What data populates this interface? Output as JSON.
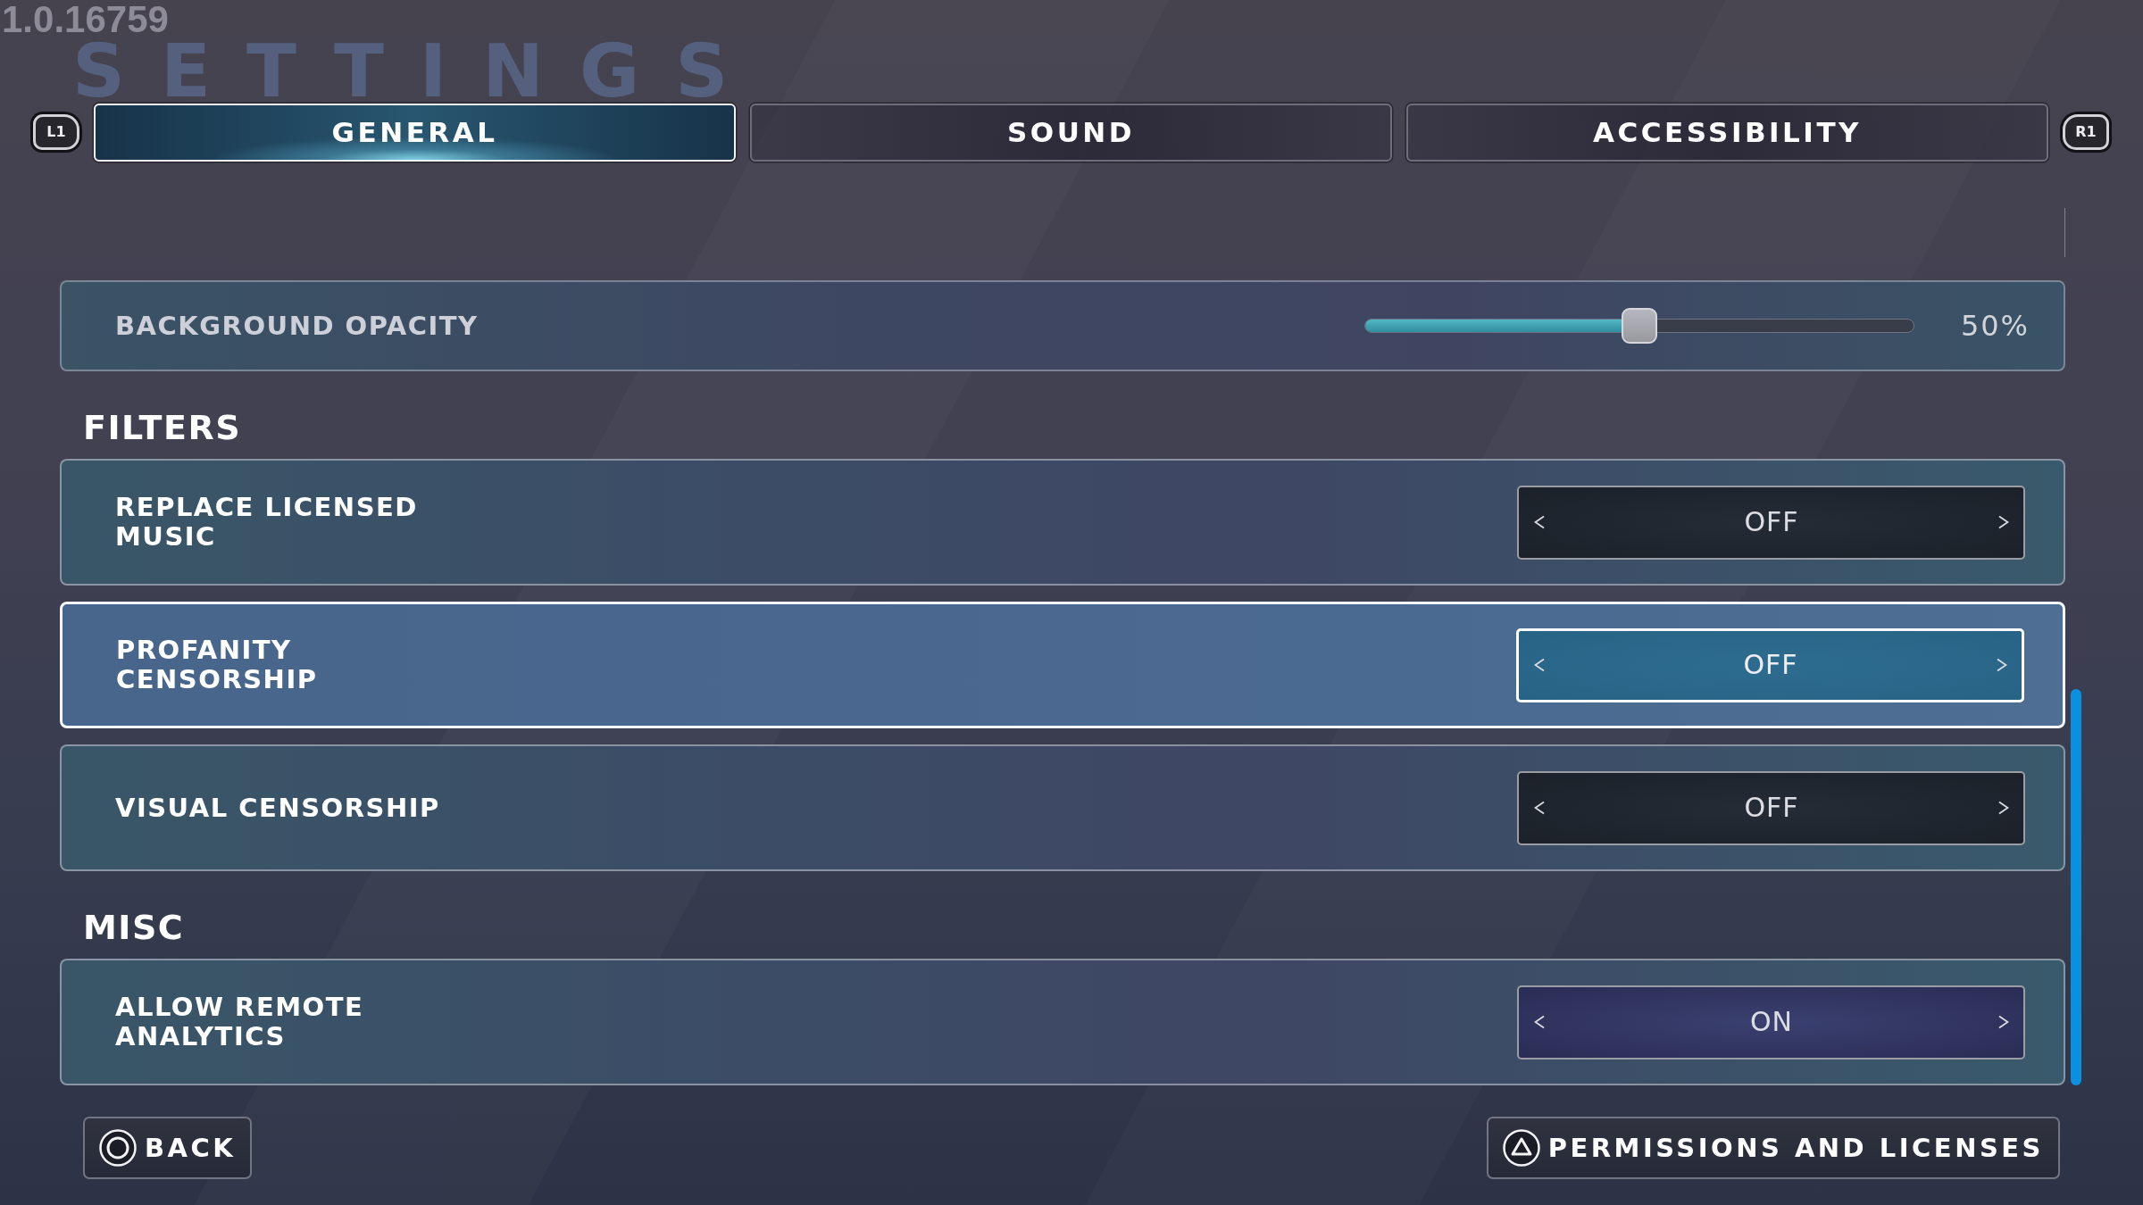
{
  "version": "1.0.16759",
  "page_title": "SETTINGS",
  "tabs": {
    "prev_hint": "L1",
    "items": [
      {
        "label": "GENERAL",
        "selected": true
      },
      {
        "label": "SOUND",
        "selected": false
      },
      {
        "label": "ACCESSIBILITY",
        "selected": false
      }
    ],
    "next_hint": "R1"
  },
  "sections": [
    {
      "rows": [
        {
          "kind": "slider",
          "label": "BACKGROUND OPACITY",
          "level": 0.5,
          "reading": "50%",
          "selected": false
        }
      ]
    },
    {
      "heading": "FILTERS",
      "rows": [
        {
          "kind": "toggle",
          "label": "REPLACE LICENSED MUSIC",
          "value": "OFF",
          "on": false,
          "selected": false
        },
        {
          "kind": "toggle",
          "label": "PROFANITY CENSORSHIP",
          "value": "OFF",
          "on": false,
          "selected": true
        },
        {
          "kind": "toggle",
          "label": "VISUAL CENSORSHIP",
          "value": "OFF",
          "on": false,
          "selected": false
        }
      ]
    },
    {
      "heading": "MISC",
      "rows": [
        {
          "kind": "toggle",
          "label": "ALLOW REMOTE ANALYTICS",
          "value": "ON",
          "on": true,
          "selected": false
        }
      ]
    }
  ],
  "footer": {
    "buttons": [
      {
        "kind": "back",
        "label": "BACK"
      },
      {
        "kind": "option",
        "label": "PERMISSIONS AND LICENSES"
      }
    ]
  }
}
